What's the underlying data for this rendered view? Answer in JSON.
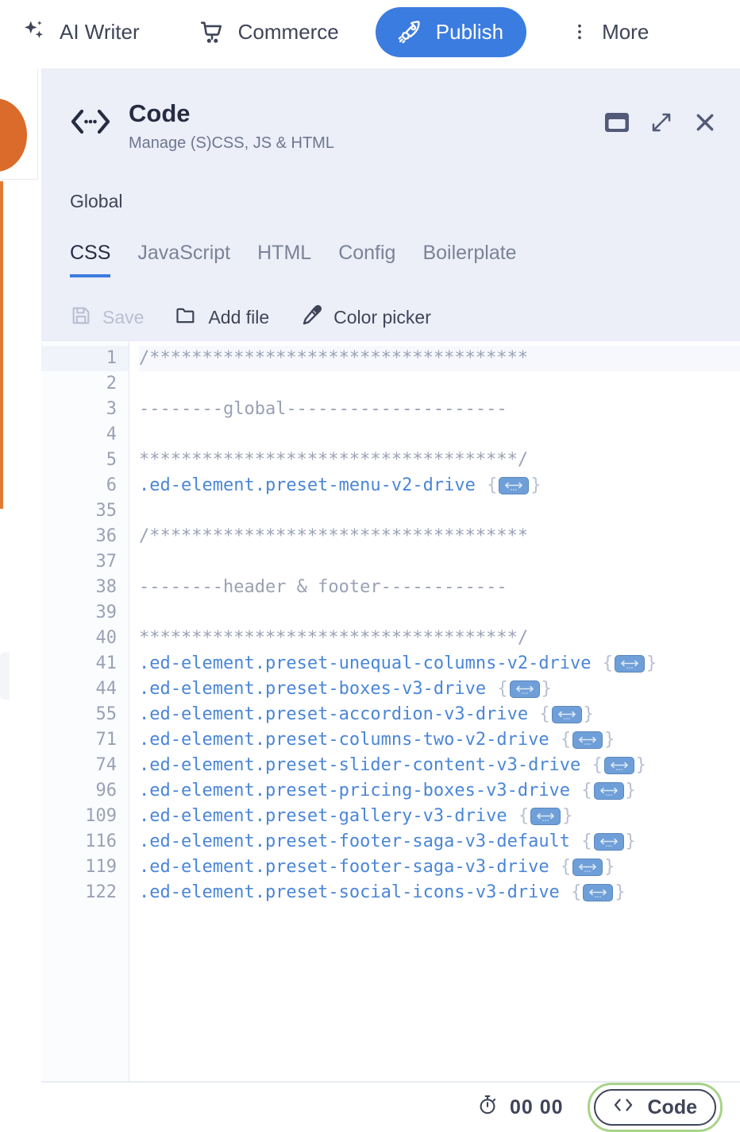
{
  "topnav": {
    "items": [
      {
        "label": "AI Writer",
        "icon": "sparkles-icon"
      },
      {
        "label": "Commerce",
        "icon": "shopping-cart-icon"
      }
    ],
    "publish": {
      "label": "Publish",
      "icon": "rocket-icon",
      "color": "#3b7ce0"
    },
    "more": {
      "label": "More",
      "icon": "kebab-menu-icon"
    }
  },
  "panel": {
    "icon": "code-brackets-icon",
    "title": "Code",
    "subtitle": "Manage (S)CSS, JS & HTML",
    "actions": [
      {
        "name": "dock-panel-icon"
      },
      {
        "name": "expand-icon"
      },
      {
        "name": "close-icon"
      }
    ],
    "scope": "Global",
    "tabs": [
      {
        "label": "CSS",
        "active": true
      },
      {
        "label": "JavaScript",
        "active": false
      },
      {
        "label": "HTML",
        "active": false
      },
      {
        "label": "Config",
        "active": false
      },
      {
        "label": "Boilerplate",
        "active": false
      }
    ],
    "active_tab_color": "#3b7ce0",
    "toolbar": [
      {
        "label": "Save",
        "icon": "floppy-disk-icon",
        "disabled": true
      },
      {
        "label": "Add file",
        "icon": "folder-icon",
        "disabled": false
      },
      {
        "label": "Color picker",
        "icon": "eyedropper-icon",
        "disabled": false
      }
    ]
  },
  "editor": {
    "line_numbers": [
      1,
      2,
      3,
      4,
      5,
      6,
      35,
      36,
      37,
      38,
      39,
      40,
      41,
      44,
      55,
      71,
      74,
      96,
      109,
      116,
      119,
      122
    ],
    "lines": [
      {
        "num": 1,
        "type": "comment",
        "text": "/************************************",
        "active": true
      },
      {
        "num": 2,
        "type": "blank",
        "text": ""
      },
      {
        "num": 3,
        "type": "comment",
        "text": "--------global---------------------"
      },
      {
        "num": 4,
        "type": "blank",
        "text": ""
      },
      {
        "num": 5,
        "type": "comment",
        "text": "************************************/"
      },
      {
        "num": 6,
        "type": "rule",
        "selector": ".ed-element.preset-menu-v2-drive",
        "folded": true
      },
      {
        "num": 35,
        "type": "blank",
        "text": ""
      },
      {
        "num": 36,
        "type": "comment",
        "text": "/************************************"
      },
      {
        "num": 37,
        "type": "blank",
        "text": ""
      },
      {
        "num": 38,
        "type": "comment",
        "text": "--------header & footer------------"
      },
      {
        "num": 39,
        "type": "blank",
        "text": ""
      },
      {
        "num": 40,
        "type": "comment",
        "text": "************************************/"
      },
      {
        "num": 41,
        "type": "rule",
        "selector": ".ed-element.preset-unequal-columns-v2-drive",
        "folded": true
      },
      {
        "num": 44,
        "type": "rule",
        "selector": ".ed-element.preset-boxes-v3-drive",
        "folded": true
      },
      {
        "num": 55,
        "type": "rule",
        "selector": ".ed-element.preset-accordion-v3-drive",
        "folded": true
      },
      {
        "num": 71,
        "type": "rule",
        "selector": ".ed-element.preset-columns-two-v2-drive",
        "folded": true
      },
      {
        "num": 74,
        "type": "rule",
        "selector": ".ed-element.preset-slider-content-v3-drive",
        "folded": true
      },
      {
        "num": 96,
        "type": "rule",
        "selector": ".ed-element.preset-pricing-boxes-v3-drive",
        "folded": true
      },
      {
        "num": 109,
        "type": "rule",
        "selector": ".ed-element.preset-gallery-v3-drive",
        "folded": true
      },
      {
        "num": 116,
        "type": "rule",
        "selector": ".ed-element.preset-footer-saga-v3-default",
        "folded": true
      },
      {
        "num": 119,
        "type": "rule",
        "selector": ".ed-element.preset-footer-saga-v3-drive",
        "folded": true
      },
      {
        "num": 122,
        "type": "rule",
        "selector": ".ed-element.preset-social-icons-v3-drive",
        "folded": true
      }
    ],
    "selector_color": "#4a86d8",
    "comment_color": "#9aa1b4"
  },
  "bottombar": {
    "timer": {
      "icon": "stopwatch-icon",
      "value": "00 00"
    },
    "code_chip": {
      "label": "Code",
      "icon": "code-angle-brackets-icon",
      "highlight_color": "#a9d38a"
    }
  }
}
